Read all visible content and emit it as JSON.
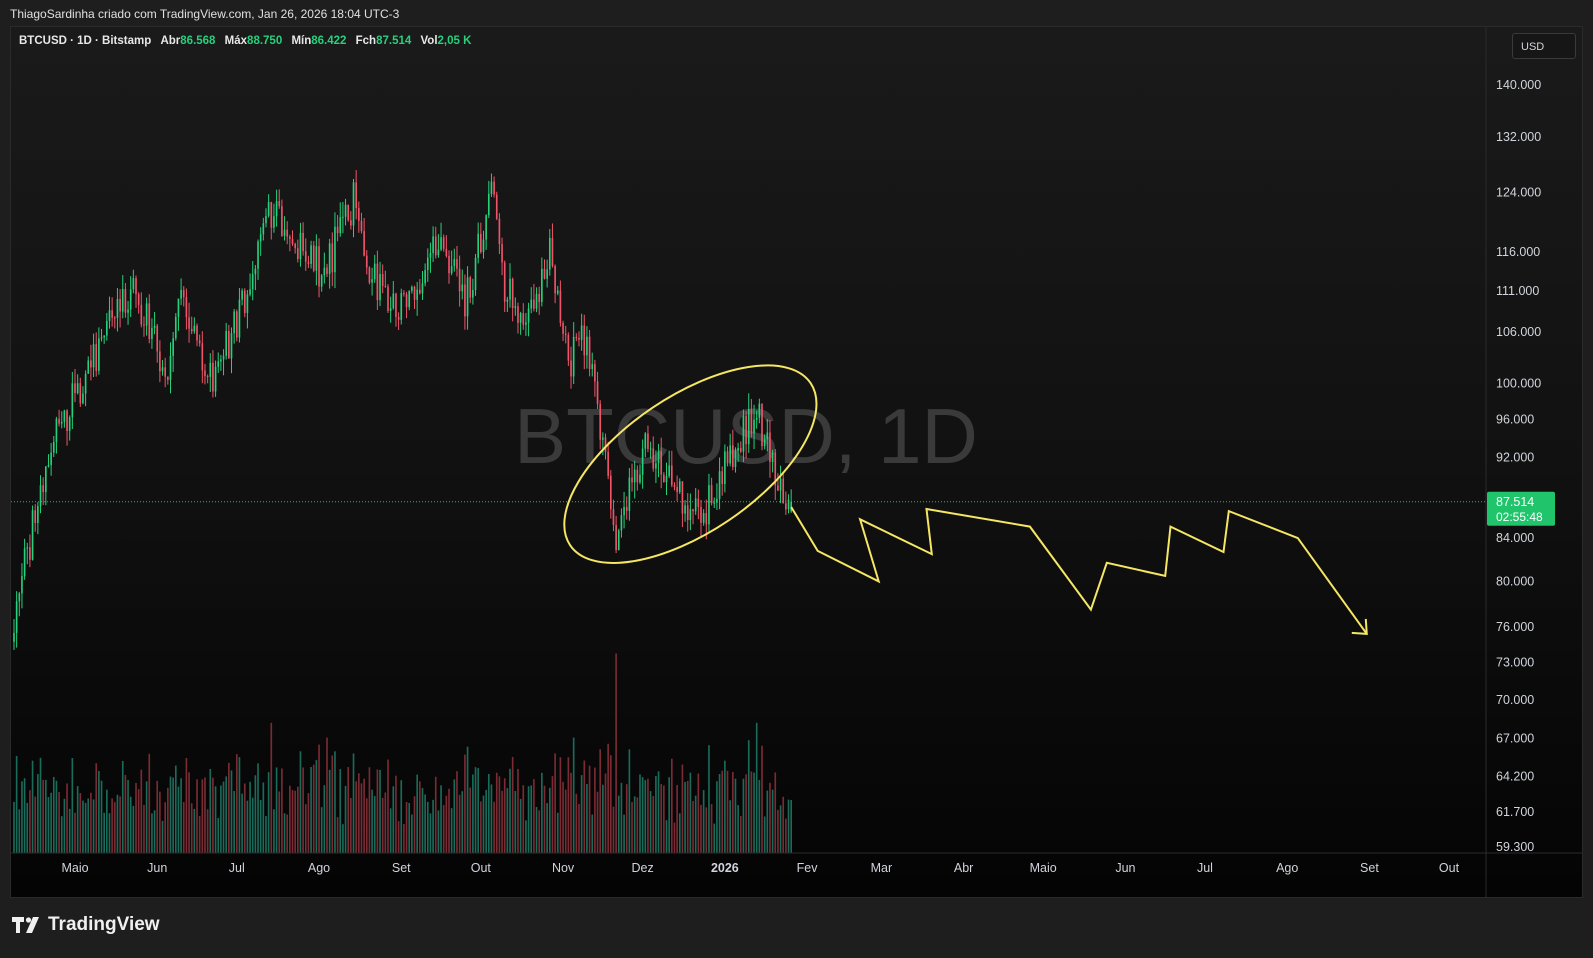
{
  "header": {
    "attribution": "ThiagoSardinha criado com TradingView.com, Jan 26, 2026 18:04 UTC-3"
  },
  "legend": {
    "symbol": "BTCUSD · 1D · Bitstamp",
    "open_label": "Abr",
    "open": "86.568",
    "high_label": "Máx",
    "high": "88.750",
    "low_label": "Mín",
    "low": "86.422",
    "close_label": "Fch",
    "close": "87.514",
    "vol_label": "Vol",
    "vol": "2,05 K"
  },
  "currency": "USD",
  "watermark": "BTCUSD, 1D",
  "last_price": {
    "price": "87.514",
    "countdown": "02:55:48"
  },
  "footer": {
    "brand": "TradingView"
  },
  "colors": {
    "up": "#26d07c",
    "down": "#f05469",
    "vol_up": "#1a6b5a",
    "vol_down": "#7a2b34",
    "annotation": "#f5e663",
    "last_price_bg": "#1fc46b",
    "price_line": "#2bb673"
  },
  "chart_data": {
    "type": "candlestick",
    "symbol": "BTCUSD",
    "interval": "1D",
    "scale": "log",
    "ylim": [
      58000,
      152000
    ],
    "y_ticks": [
      "140.000",
      "132.000",
      "124.000",
      "116.000",
      "111.000",
      "106.000",
      "100.000",
      "96.000",
      "92.000",
      "84.000",
      "80.000",
      "76.000",
      "73.000",
      "70.000",
      "67.000",
      "64.200",
      "61.700",
      "59.300"
    ],
    "y_tick_values": [
      140000,
      132000,
      124000,
      116000,
      111000,
      106000,
      100000,
      96000,
      92000,
      84000,
      80000,
      76000,
      73000,
      70000,
      67000,
      64200,
      61700,
      59300
    ],
    "x_ticks": [
      "Maio",
      "Jun",
      "Jul",
      "Ago",
      "Set",
      "Out",
      "Nov",
      "Dez",
      "2026",
      "Fev",
      "Mar",
      "Abr",
      "Maio",
      "Jun",
      "Jul",
      "Ago",
      "Set",
      "Out"
    ],
    "x_tick_dates": [
      "2025-05-01",
      "2025-06-01",
      "2025-07-01",
      "2025-08-01",
      "2025-09-01",
      "2025-10-01",
      "2025-11-01",
      "2025-12-01",
      "2026-01-01",
      "2026-02-01",
      "2026-03-01",
      "2026-04-01",
      "2026-05-01",
      "2026-06-01",
      "2026-07-01",
      "2026-08-01",
      "2026-09-01",
      "2026-10-01"
    ],
    "x_tick_bold": [
      false,
      false,
      false,
      false,
      false,
      false,
      false,
      false,
      true,
      false,
      false,
      false,
      false,
      false,
      false,
      false,
      false,
      false
    ],
    "date_range": [
      "2025-04-08",
      "2026-01-26"
    ],
    "anchors": [
      [
        "2025-04-08",
        77000
      ],
      [
        "2025-04-22",
        93500
      ],
      [
        "2025-05-08",
        103000
      ],
      [
        "2025-05-22",
        111500
      ],
      [
        "2025-06-05",
        101500
      ],
      [
        "2025-06-09",
        110000
      ],
      [
        "2025-06-22",
        100000
      ],
      [
        "2025-07-01",
        107000
      ],
      [
        "2025-07-14",
        121500
      ],
      [
        "2025-07-31",
        115000
      ],
      [
        "2025-08-02",
        112500
      ],
      [
        "2025-08-14",
        123000
      ],
      [
        "2025-08-19",
        113500
      ],
      [
        "2025-08-30",
        108000
      ],
      [
        "2025-09-13",
        116000
      ],
      [
        "2025-09-17",
        117000
      ],
      [
        "2025-09-25",
        109000
      ],
      [
        "2025-10-06",
        125000
      ],
      [
        "2025-10-10",
        112000
      ],
      [
        "2025-10-17",
        106500
      ],
      [
        "2025-10-27",
        115500
      ],
      [
        "2025-11-04",
        103000
      ],
      [
        "2025-11-10",
        106000
      ],
      [
        "2025-11-21",
        84000
      ],
      [
        "2025-11-23",
        86500
      ],
      [
        "2025-12-02",
        93000
      ],
      [
        "2025-12-08",
        92000
      ],
      [
        "2025-12-18",
        86000
      ],
      [
        "2025-12-27",
        87500
      ],
      [
        "2026-01-05",
        93500
      ],
      [
        "2026-01-14",
        96500
      ],
      [
        "2026-01-20",
        89500
      ],
      [
        "2026-01-26",
        87514
      ]
    ],
    "volume_spikes": [
      [
        "2025-07-14",
        0.62
      ],
      [
        "2025-08-04",
        0.55
      ],
      [
        "2025-11-18",
        0.52
      ],
      [
        "2025-11-21",
        0.95
      ],
      [
        "2026-01-13",
        0.62
      ]
    ],
    "last": {
      "date": "2026-01-26",
      "open": 86568,
      "high": 88750,
      "low": 86422,
      "close": 87514
    },
    "annotation": {
      "ellipse": {
        "center": [
          "2025-12-19",
          91300
        ],
        "description": "highlighted consolidation zone"
      },
      "projection": [
        [
          "2026-01-26",
          87000
        ],
        [
          "2026-02-05",
          82800
        ],
        [
          "2026-02-28",
          80000
        ],
        [
          "2026-02-21",
          85800
        ],
        [
          "2026-03-20",
          82500
        ],
        [
          "2026-03-18",
          86800
        ],
        [
          "2026-04-26",
          85100
        ],
        [
          "2026-05-19",
          77500
        ],
        [
          "2026-05-25",
          81700
        ],
        [
          "2026-06-16",
          80500
        ],
        [
          "2026-06-18",
          85100
        ],
        [
          "2026-07-08",
          82700
        ],
        [
          "2026-07-10",
          86600
        ],
        [
          "2026-08-05",
          84000
        ],
        [
          "2026-08-31",
          75400
        ]
      ],
      "arrow_end": [
        "2026-08-31",
        75400
      ]
    }
  }
}
